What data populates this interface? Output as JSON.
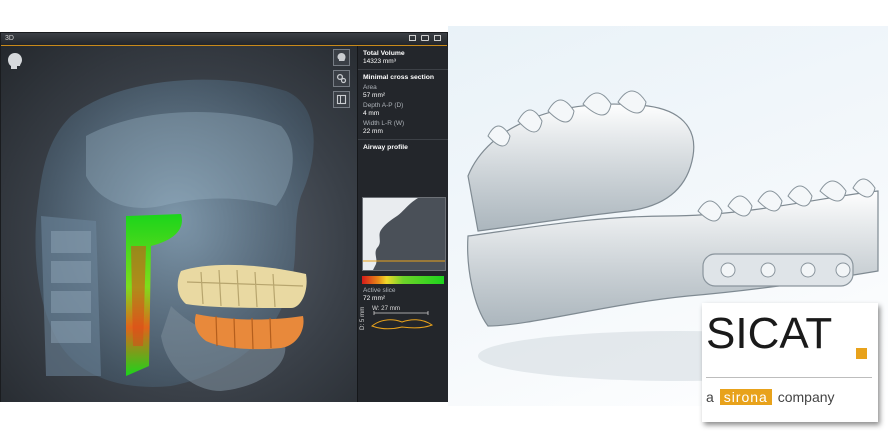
{
  "window": {
    "title": "3D"
  },
  "toolbar": {
    "icons": [
      "head-view-icon",
      "settings-gears-icon",
      "layout-icon"
    ]
  },
  "panel": {
    "total_volume": {
      "label": "Total Volume",
      "value": "14323 mm³"
    },
    "min_cross_section": {
      "title": "Minimal cross section",
      "area_label": "Area",
      "area_value": "57 mm²",
      "depth_label": "Depth A-P (D)",
      "depth_value": "4 mm",
      "width_label": "Width L-R (W)",
      "width_value": "22 mm"
    },
    "airway_profile": {
      "title": "Airway profile"
    },
    "active_slice": {
      "label": "Active slice",
      "value": "72 mm²"
    },
    "slice_width": "W: 27 mm",
    "slice_depth": "D: 5 mm"
  },
  "logo": {
    "brand": "SICAT",
    "tag_prefix": "a",
    "tag_brand": "sirona",
    "tag_suffix": "company",
    "accent": "#e8a21b"
  }
}
